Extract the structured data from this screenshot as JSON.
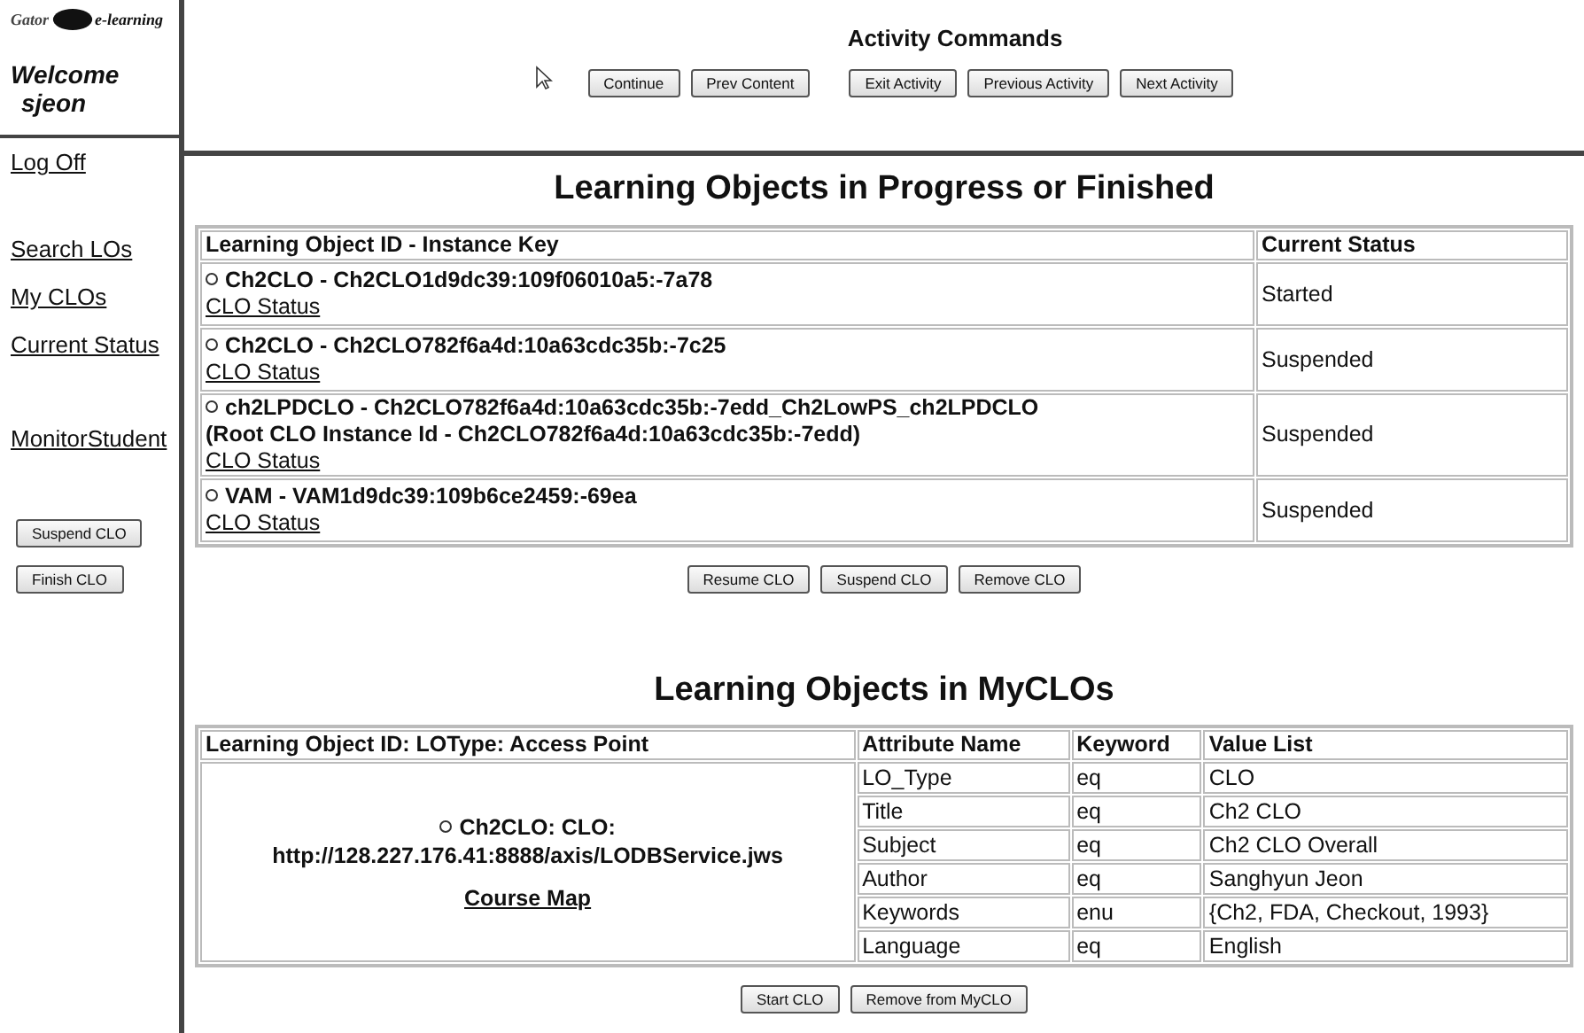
{
  "logo": {
    "left": "Gator",
    "right": "e-learning"
  },
  "welcome": {
    "greeting": "Welcome",
    "user": "sjeon"
  },
  "sidebar": {
    "top_link": "Log Off",
    "links": [
      "Search LOs",
      "My CLOs",
      "Current Status",
      "MonitorStudent"
    ],
    "buttons": [
      "Suspend CLO",
      "Finish CLO"
    ]
  },
  "activity": {
    "title": "Activity Commands",
    "buttons": [
      "Continue",
      "Prev Content",
      "Exit Activity",
      "Previous Activity",
      "Next Activity"
    ]
  },
  "progress": {
    "title": "Learning Objects in Progress or Finished",
    "columns": [
      "Learning Object ID - Instance Key",
      "Current Status"
    ],
    "rows": [
      {
        "selected": false,
        "lines": [
          "Ch2CLO - Ch2CLO1d9dc39:109f06010a5:-7a78"
        ],
        "link": "CLO Status",
        "status": "Started"
      },
      {
        "selected": false,
        "lines": [
          "Ch2CLO - Ch2CLO782f6a4d:10a63cdc35b:-7c25"
        ],
        "link": "CLO Status",
        "status": "Suspended"
      },
      {
        "selected": false,
        "lines": [
          "ch2LPDCLO - Ch2CLO782f6a4d:10a63cdc35b:-7edd_Ch2LowPS_ch2LPDCLO",
          "(Root CLO Instance Id - Ch2CLO782f6a4d:10a63cdc35b:-7edd)"
        ],
        "link": "CLO Status",
        "status": "Suspended"
      },
      {
        "selected": false,
        "lines": [
          "VAM - VAM1d9dc39:109b6ce2459:-69ea"
        ],
        "link": "CLO Status",
        "status": "Suspended"
      }
    ],
    "buttons": [
      "Resume CLO",
      "Suspend CLO",
      "Remove CLO"
    ]
  },
  "myclos": {
    "title": "Learning Objects in MyCLOs",
    "columns": [
      "Learning Object ID: LOType: Access Point",
      "Attribute Name",
      "Keyword",
      "Value List"
    ],
    "item": {
      "selected": false,
      "lines": [
        "Ch2CLO: CLO:",
        "http://128.227.176.41:8888/axis/LODBService.jws"
      ],
      "link": "Course Map"
    },
    "rows": [
      {
        "attribute": "LO_Type",
        "keyword": "eq",
        "value": "CLO"
      },
      {
        "attribute": "Title",
        "keyword": "eq",
        "value": "Ch2 CLO"
      },
      {
        "attribute": "Subject",
        "keyword": "eq",
        "value": "Ch2 CLO Overall"
      },
      {
        "attribute": "Author",
        "keyword": "eq",
        "value": "Sanghyun Jeon"
      },
      {
        "attribute": "Keywords",
        "keyword": "enu",
        "value": "{Ch2, FDA, Checkout, 1993}"
      },
      {
        "attribute": "Language",
        "keyword": "eq",
        "value": "English"
      }
    ],
    "buttons": [
      "Start CLO",
      "Remove from MyCLO"
    ]
  }
}
